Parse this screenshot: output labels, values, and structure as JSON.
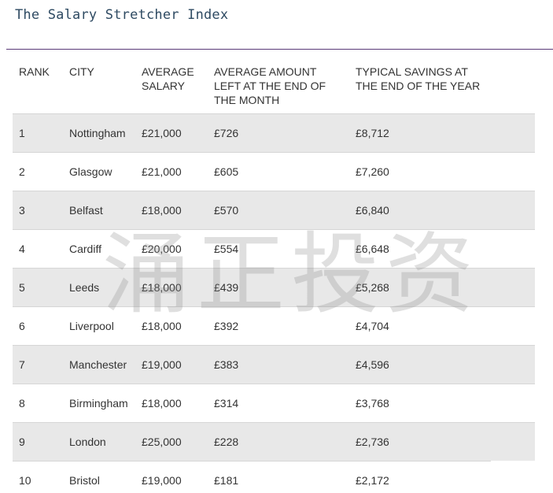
{
  "title": "The Salary Stretcher Index",
  "table": {
    "headers": {
      "rank": "RANK",
      "city": "CITY",
      "salary": "AVERAGE SALARY",
      "left": "AVERAGE AMOUNT LEFT AT THE END OF THE MONTH",
      "savings": "TYPICAL SAVINGS AT THE END OF THE YEAR"
    },
    "rows": [
      {
        "rank": "1",
        "city": "Nottingham",
        "salary": "£21,000",
        "left": "£726",
        "savings": "£8,712"
      },
      {
        "rank": "2",
        "city": "Glasgow",
        "salary": "£21,000",
        "left": "£605",
        "savings": "£7,260"
      },
      {
        "rank": "3",
        "city": "Belfast",
        "salary": "£18,000",
        "left": "£570",
        "savings": "£6,840"
      },
      {
        "rank": "4",
        "city": "Cardiff",
        "salary": "£20,000",
        "left": "£554",
        "savings": "£6,648"
      },
      {
        "rank": "5",
        "city": "Leeds",
        "salary": "£18,000",
        "left": "£439",
        "savings": "£5,268"
      },
      {
        "rank": "6",
        "city": "Liverpool",
        "salary": "£18,000",
        "left": "£392",
        "savings": "£4,704"
      },
      {
        "rank": "7",
        "city": "Manchester",
        "salary": "£19,000",
        "left": "£383",
        "savings": "£4,596"
      },
      {
        "rank": "8",
        "city": "Birmingham",
        "salary": "£18,000",
        "left": "£314",
        "savings": "£3,768"
      },
      {
        "rank": "9",
        "city": "London",
        "salary": "£25,000",
        "left": "£228",
        "savings": "£2,736"
      },
      {
        "rank": "10",
        "city": "Bristol",
        "salary": "£19,000",
        "left": "£181",
        "savings": "£2,172"
      }
    ]
  },
  "watermark": "涌正投资",
  "colors": {
    "title": "#2e4a62",
    "rule": "#5a3a78",
    "shaded_row": "#e8e8e8",
    "text": "#333333"
  }
}
